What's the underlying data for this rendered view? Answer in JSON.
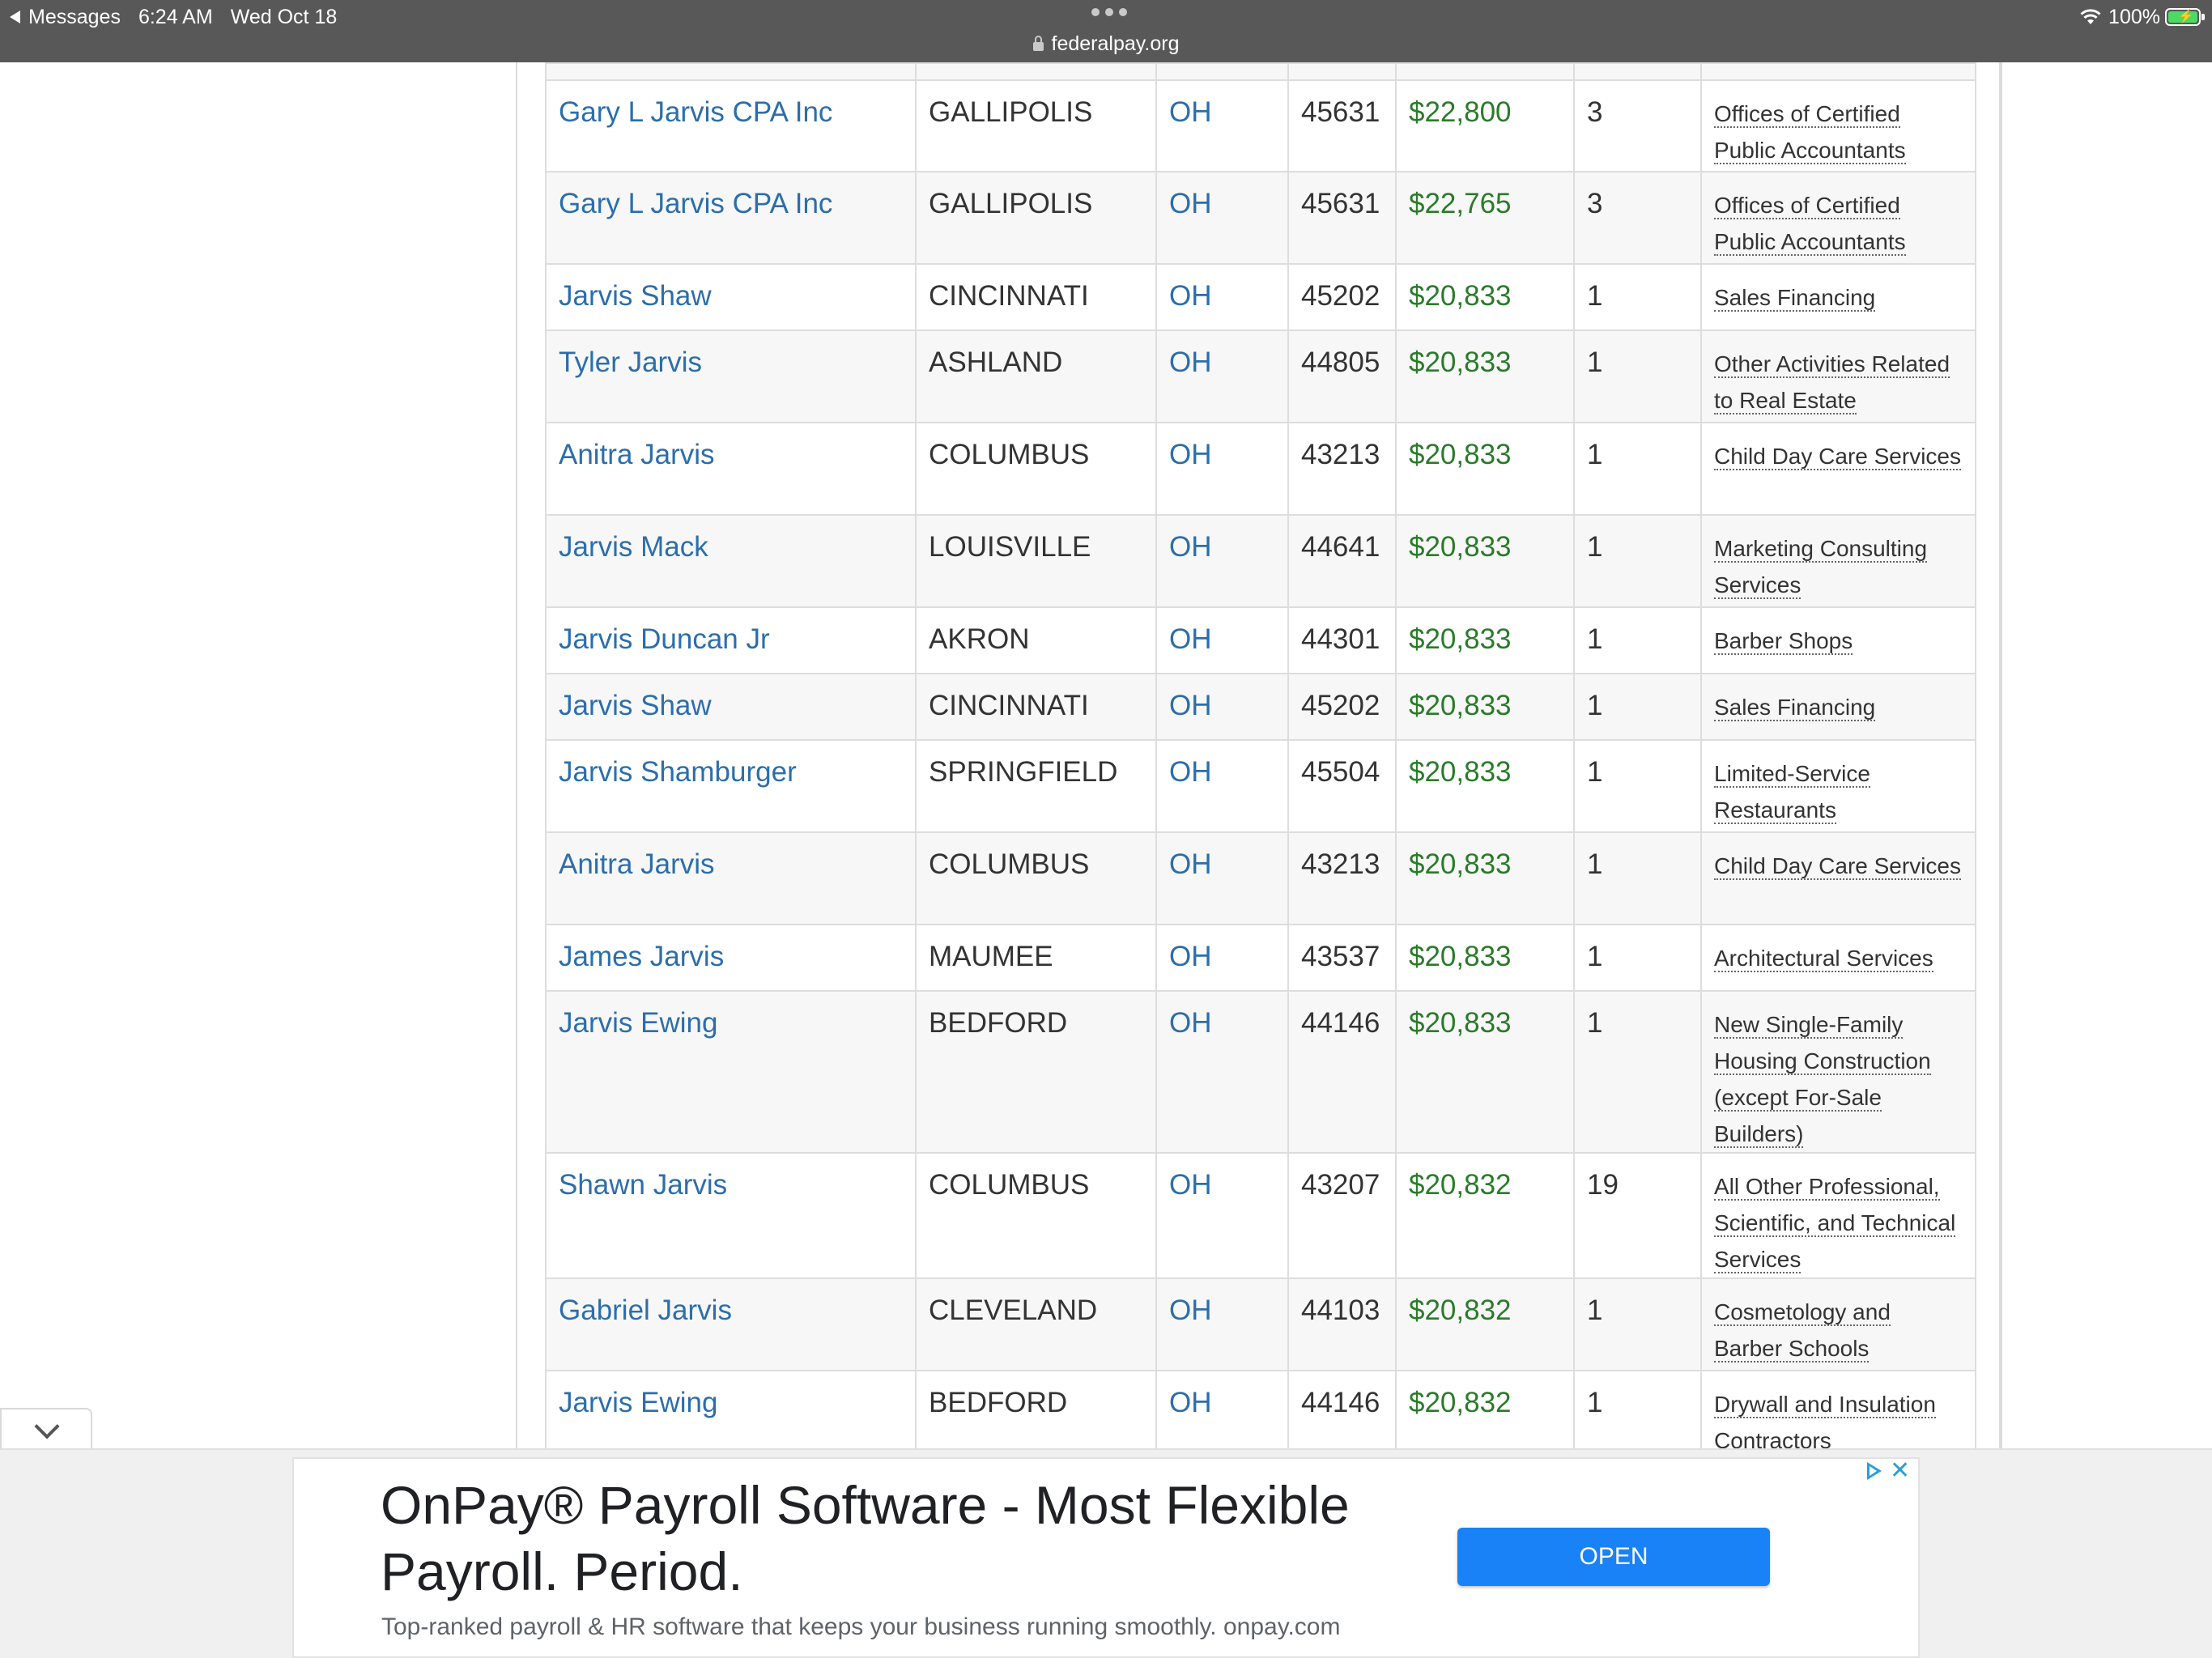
{
  "status_bar": {
    "back_app": "Messages",
    "time": "6:24 AM",
    "date": "Wed Oct 18",
    "url": "federalpay.org",
    "battery": "100%"
  },
  "rows": [
    {
      "name": "Gary L Jarvis CPA Inc",
      "city": "GALLIPOLIS",
      "state": "OH",
      "zip": "45631",
      "amount": "$22,800",
      "jobs": "3",
      "industry": "Offices of Certified Public Accountants"
    },
    {
      "name": "Gary L Jarvis CPA Inc",
      "city": "GALLIPOLIS",
      "state": "OH",
      "zip": "45631",
      "amount": "$22,765",
      "jobs": "3",
      "industry": "Offices of Certified Public Accountants"
    },
    {
      "name": "Jarvis Shaw",
      "city": "CINCINNATI",
      "state": "OH",
      "zip": "45202",
      "amount": "$20,833",
      "jobs": "1",
      "industry": "Sales Financing"
    },
    {
      "name": "Tyler Jarvis",
      "city": "ASHLAND",
      "state": "OH",
      "zip": "44805",
      "amount": "$20,833",
      "jobs": "1",
      "industry": "Other Activities Related to Real Estate"
    },
    {
      "name": "Anitra Jarvis",
      "city": "COLUMBUS",
      "state": "OH",
      "zip": "43213",
      "amount": "$20,833",
      "jobs": "1",
      "industry": "Child Day Care Services"
    },
    {
      "name": "Jarvis Mack",
      "city": "LOUISVILLE",
      "state": "OH",
      "zip": "44641",
      "amount": "$20,833",
      "jobs": "1",
      "industry": "Marketing Consulting Services"
    },
    {
      "name": "Jarvis Duncan Jr",
      "city": "AKRON",
      "state": "OH",
      "zip": "44301",
      "amount": "$20,833",
      "jobs": "1",
      "industry": "Barber Shops"
    },
    {
      "name": "Jarvis Shaw",
      "city": "CINCINNATI",
      "state": "OH",
      "zip": "45202",
      "amount": "$20,833",
      "jobs": "1",
      "industry": "Sales Financing"
    },
    {
      "name": "Jarvis Shamburger",
      "city": "SPRINGFIELD",
      "state": "OH",
      "zip": "45504",
      "amount": "$20,833",
      "jobs": "1",
      "industry": "Limited-Service Restaurants"
    },
    {
      "name": "Anitra Jarvis",
      "city": "COLUMBUS",
      "state": "OH",
      "zip": "43213",
      "amount": "$20,833",
      "jobs": "1",
      "industry": "Child Day Care Services"
    },
    {
      "name": "James Jarvis",
      "city": "MAUMEE",
      "state": "OH",
      "zip": "43537",
      "amount": "$20,833",
      "jobs": "1",
      "industry": "Architectural Services"
    },
    {
      "name": "Jarvis Ewing",
      "city": "BEDFORD",
      "state": "OH",
      "zip": "44146",
      "amount": "$20,833",
      "jobs": "1",
      "industry": "New Single-Family Housing Construction (except For-Sale Builders)"
    },
    {
      "name": "Shawn Jarvis",
      "city": "COLUMBUS",
      "state": "OH",
      "zip": "43207",
      "amount": "$20,832",
      "jobs": "19",
      "industry": "All Other Professional, Scientific, and Technical Services"
    },
    {
      "name": "Gabriel Jarvis",
      "city": "CLEVELAND",
      "state": "OH",
      "zip": "44103",
      "amount": "$20,832",
      "jobs": "1",
      "industry": "Cosmetology and Barber Schools"
    },
    {
      "name": "Jarvis Ewing",
      "city": "BEDFORD",
      "state": "OH",
      "zip": "44146",
      "amount": "$20,832",
      "jobs": "1",
      "industry": "Drywall and Insulation Contractors"
    }
  ],
  "ad": {
    "title": "OnPay® Payroll Software - Most Flexible Payroll. Period.",
    "description": "Top-ranked payroll & HR software that keeps your business running smoothly. onpay.com",
    "button_label": "OPEN"
  }
}
